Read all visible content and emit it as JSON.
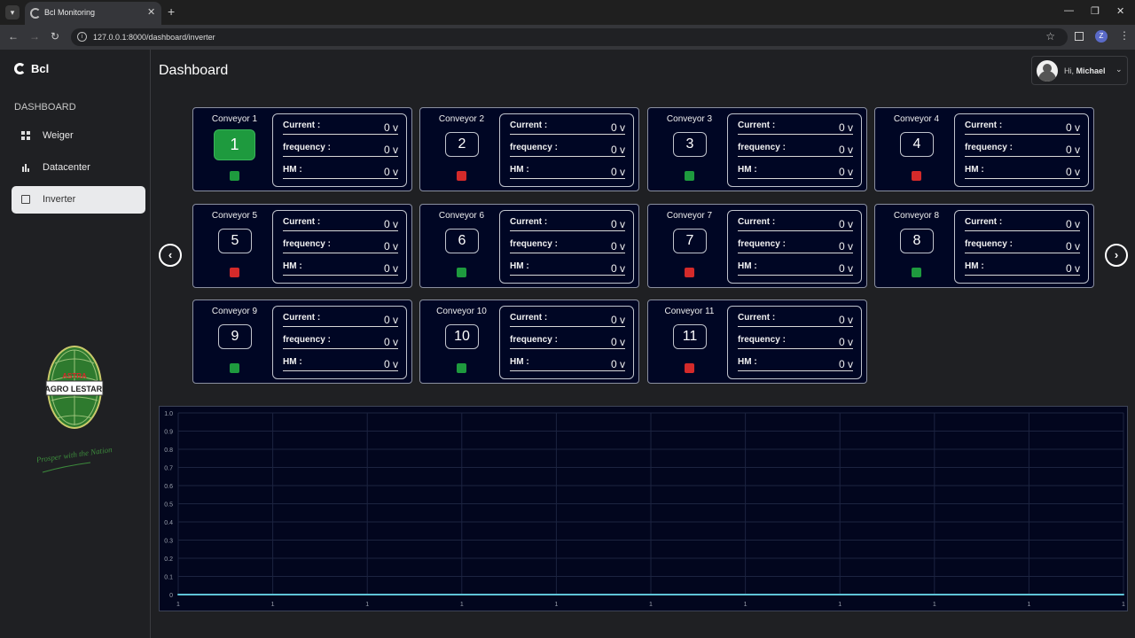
{
  "browser": {
    "tab_title": "Bcl Monitoring",
    "url": "127.0.0.1:8000/dashboard/inverter",
    "profile_initial": "Z",
    "new_tab_glyph": "+",
    "close_glyph": "✕"
  },
  "sidebar": {
    "brand": "Bcl",
    "section_label": "DASHBOARD",
    "items": [
      {
        "label": "Weiger",
        "icon": "grid-icon",
        "active": false
      },
      {
        "label": "Datacenter",
        "icon": "bar-chart-icon",
        "active": false
      },
      {
        "label": "Inverter",
        "icon": "inverter-icon",
        "active": true
      }
    ],
    "logo": {
      "top_text": "ASTRA",
      "band_text": "AGRO LESTARI",
      "tagline": "Prosper with the Nation"
    }
  },
  "header": {
    "title": "Dashboard",
    "greeting_prefix": "Hi,",
    "user_name": "Michael"
  },
  "carousel": {
    "prev": "‹",
    "next": "›"
  },
  "conveyors": [
    {
      "name": "Conveyor 1",
      "number": "1",
      "status_color": "#1e9a3e",
      "selected": true,
      "current_label": "Current :",
      "current": "0 v",
      "frequency_label": "frequency :",
      "frequency": "0 v",
      "hm_label": "HM :",
      "hm": "0 v"
    },
    {
      "name": "Conveyor 2",
      "number": "2",
      "status_color": "#d42a2a",
      "selected": false,
      "current_label": "Current :",
      "current": "0 v",
      "frequency_label": "frequency :",
      "frequency": "0 v",
      "hm_label": "HM :",
      "hm": "0 v"
    },
    {
      "name": "Conveyor 3",
      "number": "3",
      "status_color": "#1e9a3e",
      "selected": false,
      "current_label": "Current :",
      "current": "0 v",
      "frequency_label": "frequency :",
      "frequency": "0 v",
      "hm_label": "HM :",
      "hm": "0 v"
    },
    {
      "name": "Conveyor 4",
      "number": "4",
      "status_color": "#d42a2a",
      "selected": false,
      "current_label": "Current :",
      "current": "0 v",
      "frequency_label": "frequency :",
      "frequency": "0 v",
      "hm_label": "HM :",
      "hm": "0 v"
    },
    {
      "name": "Conveyor 5",
      "number": "5",
      "status_color": "#d42a2a",
      "selected": false,
      "current_label": "Current :",
      "current": "0 v",
      "frequency_label": "frequency :",
      "frequency": "0 v",
      "hm_label": "HM :",
      "hm": "0 v"
    },
    {
      "name": "Conveyor 6",
      "number": "6",
      "status_color": "#1e9a3e",
      "selected": false,
      "current_label": "Current :",
      "current": "0 v",
      "frequency_label": "frequency :",
      "frequency": "0 v",
      "hm_label": "HM :",
      "hm": "0 v"
    },
    {
      "name": "Conveyor 7",
      "number": "7",
      "status_color": "#d42a2a",
      "selected": false,
      "current_label": "Current :",
      "current": "0 v",
      "frequency_label": "frequency :",
      "frequency": "0 v",
      "hm_label": "HM :",
      "hm": "0 v"
    },
    {
      "name": "Conveyor 8",
      "number": "8",
      "status_color": "#1e9a3e",
      "selected": false,
      "current_label": "Current :",
      "current": "0 v",
      "frequency_label": "frequency :",
      "frequency": "0 v",
      "hm_label": "HM :",
      "hm": "0 v"
    },
    {
      "name": "Conveyor 9",
      "number": "9",
      "status_color": "#1e9a3e",
      "selected": false,
      "current_label": "Current :",
      "current": "0 v",
      "frequency_label": "frequency :",
      "frequency": "0 v",
      "hm_label": "HM :",
      "hm": "0 v"
    },
    {
      "name": "Conveyor 10",
      "number": "10",
      "status_color": "#1e9a3e",
      "selected": false,
      "current_label": "Current :",
      "current": "0 v",
      "frequency_label": "frequency :",
      "frequency": "0 v",
      "hm_label": "HM :",
      "hm": "0 v"
    },
    {
      "name": "Conveyor 11",
      "number": "11",
      "status_color": "#d42a2a",
      "selected": false,
      "current_label": "Current :",
      "current": "0 v",
      "frequency_label": "frequency :",
      "frequency": "0 v",
      "hm_label": "HM :",
      "hm": "0 v"
    }
  ],
  "chart_data": {
    "type": "line",
    "title": "",
    "xlabel": "",
    "ylabel": "",
    "x": [
      "1",
      "1",
      "1",
      "1",
      "1",
      "1",
      "1",
      "1",
      "1",
      "1",
      "1"
    ],
    "series": [
      {
        "values": [
          0,
          0,
          0,
          0,
          0,
          0,
          0,
          0,
          0,
          0,
          0
        ],
        "color": "#5fc3d6"
      }
    ],
    "ylim": [
      0,
      1.0
    ],
    "yticks": [
      "0",
      "0.1",
      "0.2",
      "0.3",
      "0.4",
      "0.5",
      "0.6",
      "0.7",
      "0.8",
      "0.9",
      "1.0"
    ],
    "grid": true,
    "legend": "none"
  }
}
